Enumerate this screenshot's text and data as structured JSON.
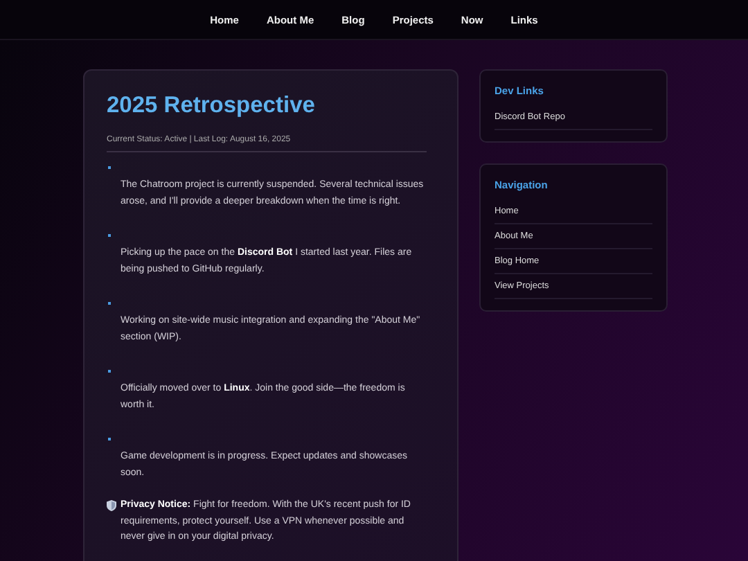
{
  "nav": [
    {
      "label": "Home"
    },
    {
      "label": "About Me"
    },
    {
      "label": "Blog"
    },
    {
      "label": "Projects"
    },
    {
      "label": "Now"
    },
    {
      "label": "Links"
    }
  ],
  "post": {
    "title": "2025 Retrospective",
    "meta": "Current Status: Active | Last Log: August 16, 2025",
    "items": [
      "The Chatroom project is currently suspended. Several technical issues arose, and I'll provide a deeper breakdown when the time is right.",
      "Picking up the pace on the **Discord Bot** I started last year. Files are being pushed to GitHub regularly.",
      "Working on site-wide music integration and expanding the \"About Me\" section (WIP).",
      "Officially moved over to **Linux**. Join the good side—the freedom is worth it.",
      "Game development is in progress. Expect updates and showcases soon."
    ],
    "notice": "**Privacy Notice:** Fight for freedom. With the UK's recent push for ID requirements, protect yourself. Use a VPN whenever possible and never give in on your digital privacy."
  },
  "sidebar": [
    {
      "title": "Dev Links",
      "links": [
        "Discord Bot Repo"
      ]
    },
    {
      "title": "Navigation",
      "links": [
        "Home",
        "About Me",
        "Blog Home",
        "View Projects"
      ]
    }
  ]
}
